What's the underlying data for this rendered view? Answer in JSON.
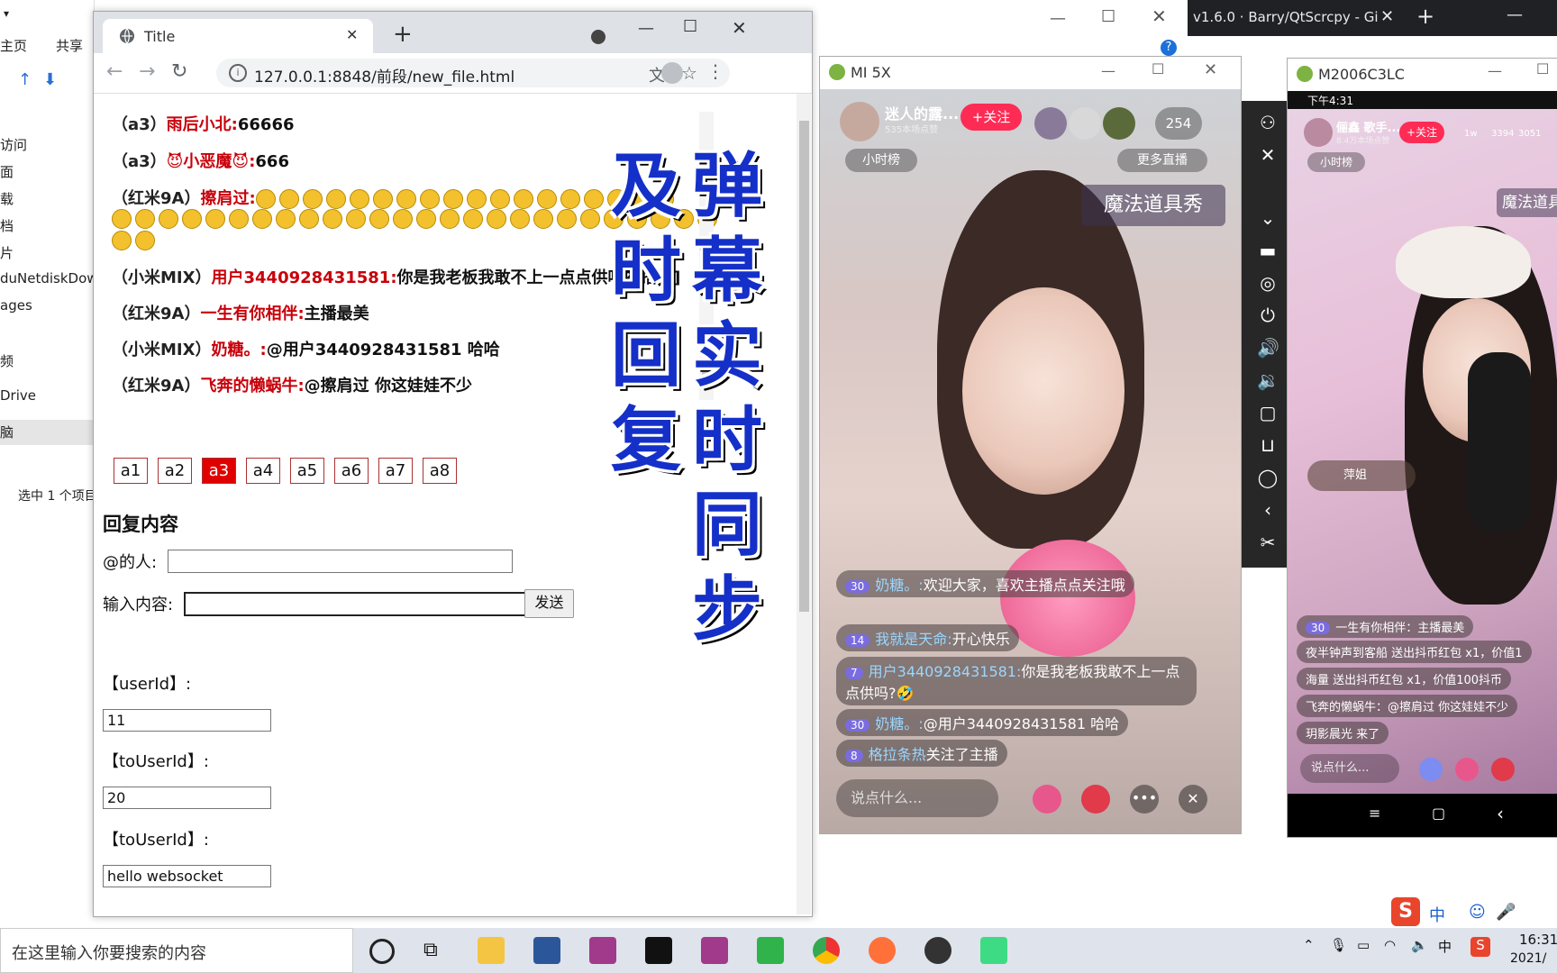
{
  "explorer": {
    "items": [
      "主页",
      "共享",
      "访问",
      "面",
      "载",
      "档",
      "片",
      "duNetdiskDow",
      "ages",
      "频",
      "Drive",
      "脑"
    ],
    "status": "选中 1 个项目"
  },
  "bg_window": {
    "title": "v1.6.0 · Barry/QtScrcpy - Gi"
  },
  "browser": {
    "tab_title": "Title",
    "url": "127.0.0.1:8848/前段/new_file.html",
    "messages": [
      {
        "device": "（a3）",
        "nick": "雨后小北:",
        "text": "66666"
      },
      {
        "device": "（a3）",
        "nick": "😈小恶魔😈:",
        "text": "666"
      },
      {
        "device": "（红米9A）",
        "nick": "擦肩过:",
        "text": ""
      },
      {
        "device": "（小米MIX）",
        "nick": "用户3440928431581:",
        "text": "你是我老板我敢不上一点点供吗?[捂脸]"
      },
      {
        "device": "（红米9A）",
        "nick": "一生有你相伴:",
        "text": "主播最美"
      },
      {
        "device": "（小米MIX）",
        "nick": "奶糖。:",
        "text": "@用户3440928431581 哈哈"
      },
      {
        "device": "（红米9A）",
        "nick": "飞奔的懒蜗牛:",
        "text": "@擦肩过 你这娃娃不少"
      }
    ],
    "buttons": [
      "a1",
      "a2",
      "a3",
      "a4",
      "a5",
      "a6",
      "a7",
      "a8"
    ],
    "active_button": "a3",
    "reply_title": "回复内容",
    "at_label": "@的人:",
    "at_value": "",
    "input_label": "输入内容:",
    "input_value": "",
    "send_label": "发送",
    "userId_label": "【userId】:",
    "userId_value": "11",
    "toUserId_label": "【toUserId】:",
    "toUserId_value": "20",
    "toUserId2_label": "【toUserId】:",
    "message_value": "hello websocket"
  },
  "overlay": {
    "col1": "及时回复",
    "col2": "弹幕实时同步"
  },
  "phone1": {
    "window_title": "MI 5X",
    "anchor_name": "迷人的露...",
    "anchor_sub": "535本场点赞",
    "follow": "+关注",
    "viewers": "254",
    "hour_rank": "小时榜",
    "more_live": "更多直播",
    "banner": "魔法道具秀",
    "comments": [
      {
        "lv": "30",
        "name": "奶糖。:",
        "text": "欢迎大家，喜欢主播点点关注哦"
      },
      {
        "lv": "14",
        "name": "我就是天命:",
        "text": "开心快乐"
      },
      {
        "lv": "7",
        "name": "用户3440928431581:",
        "text": "你是我老板我敢不上一点点供吗?🤣"
      },
      {
        "lv": "30",
        "name": "奶糖。:",
        "text": "@用户3440928431581 哈哈"
      },
      {
        "lv": "8",
        "name": "格拉条热",
        "text": "关注了主播"
      }
    ],
    "say_placeholder": "说点什么..."
  },
  "phone2": {
    "window_title": "M2006C3LC",
    "time": "下午4:31",
    "anchor_name": "俪鑫 歌手...",
    "anchor_sub": "8.4万本场点赞",
    "follow": "+关注",
    "stats": [
      "1w",
      "3394",
      "3051"
    ],
    "hour_rank": "小时榜",
    "banner": "魔法道具",
    "gift_user": "萍姐",
    "comments": [
      {
        "lv": "30",
        "text": "一生有你相伴：主播最美"
      },
      {
        "lv": "",
        "text": "夜半钟声到客船 送出抖币红包 x1，价值1"
      },
      {
        "lv": "",
        "text": "海量 送出抖币红包 x1，价值100抖币"
      },
      {
        "lv": "",
        "text": "飞奔的懒蜗牛：@擦肩过 你这娃娃不少"
      },
      {
        "lv": "",
        "text": "玥影晨光 来了"
      }
    ],
    "say_placeholder": "说点什么..."
  },
  "taskbar": {
    "search_placeholder": "在这里输入你要搜索的内容",
    "time": "16:31",
    "date": "2021/",
    "ime": "中"
  }
}
